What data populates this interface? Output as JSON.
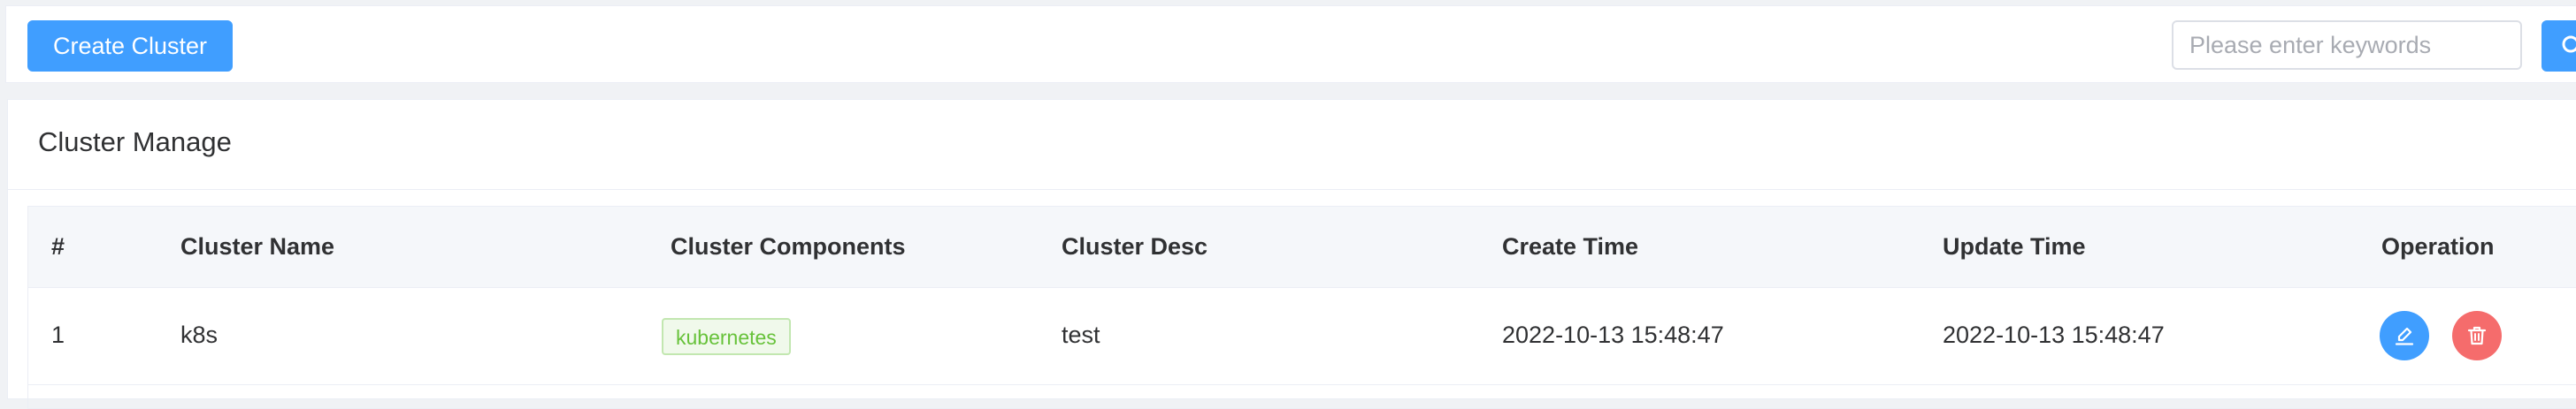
{
  "toolbar": {
    "create_label": "Create Cluster",
    "search_placeholder": "Please enter keywords",
    "search_icon": "search-icon"
  },
  "card": {
    "title": "Cluster Manage"
  },
  "table": {
    "columns": [
      "#",
      "Cluster Name",
      "Cluster Components",
      "Cluster Desc",
      "Create Time",
      "Update Time",
      "Operation"
    ],
    "rows": [
      {
        "index": "1",
        "name": "k8s",
        "component": "kubernetes",
        "desc": "test",
        "create_time": "2022-10-13 15:48:47",
        "update_time": "2022-10-13 15:48:47",
        "operations": [
          "edit-icon",
          "delete-icon"
        ]
      }
    ]
  },
  "colors": {
    "primary": "#409eff",
    "danger": "#f56c6c",
    "success": "#67c23a"
  }
}
